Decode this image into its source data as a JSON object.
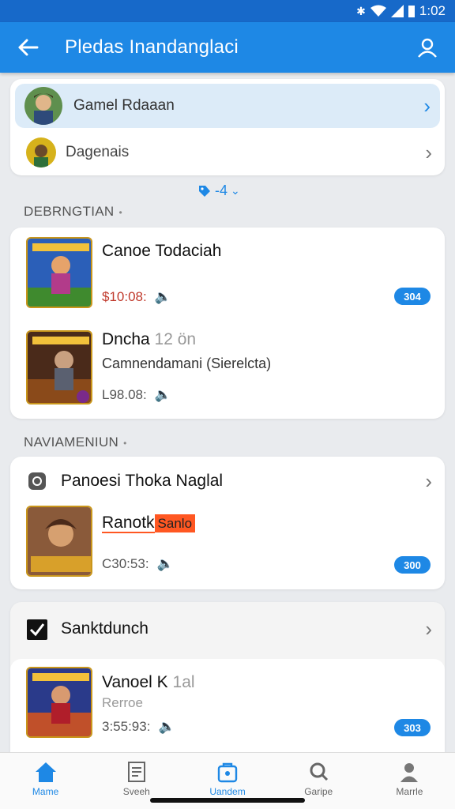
{
  "status": {
    "time": "1:02"
  },
  "appbar": {
    "title": "Pledas Inandanglaci"
  },
  "accounts": [
    {
      "label": "Gamel Rdaaan"
    },
    {
      "label": "Dagenais"
    }
  ],
  "filter": {
    "label": "-4"
  },
  "section1": {
    "heading": "DEBRNGTIAN",
    "games": [
      {
        "title": "Canoe Todaciah",
        "price": "$10:08:",
        "badge": "304"
      },
      {
        "title": "Dncha",
        "title_faint": "12 ön",
        "subtitle": "Camnendamani (Sierelcta)",
        "price": "L98.08:"
      }
    ]
  },
  "section2": {
    "heading": "NAVIAMENIUN",
    "header_label": "Panoesi Thoka Naglal",
    "game": {
      "title": "Ranotk",
      "highlight": "Sanlo",
      "price": "C30:53:",
      "badge": "300"
    }
  },
  "section3": {
    "header_label": "Sanktdunch",
    "game": {
      "title": "Vanoel K",
      "title_faint": "1al",
      "subtitle": "Rerroe",
      "price": "3:55:93:",
      "badge": "303"
    }
  },
  "nav": [
    {
      "label": "Mame"
    },
    {
      "label": "Sveeh"
    },
    {
      "label": "Uandem"
    },
    {
      "label": "Garipe"
    },
    {
      "label": "Marrle"
    }
  ],
  "colors": {
    "primary": "#1e88e5",
    "statusbar": "#1769c9",
    "background": "#e9ebee",
    "highlight": "#ff5722"
  }
}
